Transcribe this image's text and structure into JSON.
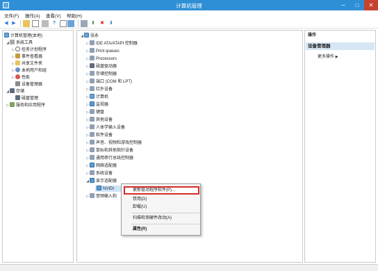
{
  "window": {
    "title": "计算机管理"
  },
  "menu": [
    "文件(F)",
    "操作(A)",
    "查看(V)",
    "帮助(H)"
  ],
  "left_tree": {
    "items": [
      {
        "label": "计算机管理(本地)",
        "arrow": ""
      },
      {
        "label": "系统工具",
        "arrow": "◢"
      },
      {
        "label": "任务计划程序",
        "arrow": "▷"
      },
      {
        "label": "事件查看器",
        "arrow": "▷"
      },
      {
        "label": "共享文件夹",
        "arrow": "▷"
      },
      {
        "label": "本地用户和组",
        "arrow": "▷"
      },
      {
        "label": "性能",
        "arrow": "▷"
      },
      {
        "label": "设备管理器",
        "arrow": ""
      },
      {
        "label": "存储",
        "arrow": "◢"
      },
      {
        "label": "磁盘管理",
        "arrow": ""
      },
      {
        "label": "服务和应用程序",
        "arrow": "▷"
      }
    ]
  },
  "device_tree": {
    "items": [
      {
        "label": "张永",
        "arrow": "◢"
      },
      {
        "label": "IDE ATA/ATAPI 控制器",
        "arrow": "▷"
      },
      {
        "label": "Print queues",
        "arrow": "▷"
      },
      {
        "label": "Processors",
        "arrow": "▷"
      },
      {
        "label": "磁盘驱动器",
        "arrow": "▷"
      },
      {
        "label": "存储控制器",
        "arrow": "▷"
      },
      {
        "label": "端口 (COM 和 LPT)",
        "arrow": "▷"
      },
      {
        "label": "红外设备",
        "arrow": "▷"
      },
      {
        "label": "计算机",
        "arrow": "▷"
      },
      {
        "label": "监视器",
        "arrow": "▷"
      },
      {
        "label": "键盘",
        "arrow": "▷"
      },
      {
        "label": "其他设备",
        "arrow": "▷"
      },
      {
        "label": "人体学输入设备",
        "arrow": "▷"
      },
      {
        "label": "软件设备",
        "arrow": "▷"
      },
      {
        "label": "声音、视频和游戏控制器",
        "arrow": "▷"
      },
      {
        "label": "鼠标和其他指针设备",
        "arrow": "▷"
      },
      {
        "label": "通用串行总线控制器",
        "arrow": "▷"
      },
      {
        "label": "网络适配器",
        "arrow": "▷"
      },
      {
        "label": "系统设备",
        "arrow": "▷"
      },
      {
        "label": "显示适配器",
        "arrow": "◢"
      },
      {
        "label": "NVIDI",
        "arrow": ""
      },
      {
        "label": "音频输入和",
        "arrow": "▷"
      }
    ]
  },
  "actions": {
    "header": "操作",
    "section": "设备管理器",
    "more": "更多操作"
  },
  "context_menu": {
    "items": [
      "更新驱动程序软件(P)...",
      "禁用(D)",
      "卸载(U)",
      "扫描检测硬件改动(A)",
      "属性(R)"
    ]
  }
}
